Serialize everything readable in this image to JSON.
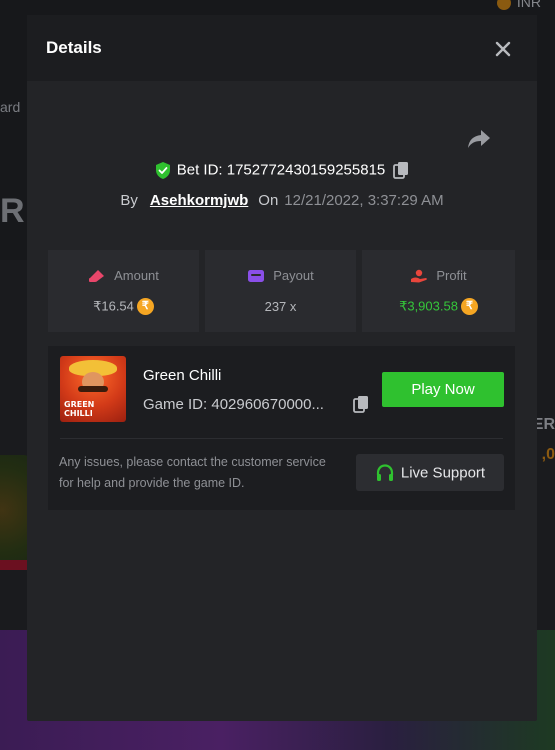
{
  "background": {
    "left_fragment": "ard",
    "big_fragment": "R",
    "top_right_currency": "INR",
    "right_fragment": "ER",
    "right_number": ",0"
  },
  "modal": {
    "title": "Details",
    "bet": {
      "label": "Bet ID:",
      "id": "1752772430159255815"
    },
    "by_label": "By",
    "username": "Asehkormjwb",
    "on_label": "On",
    "datetime": "12/21/2022, 3:37:29 AM",
    "stats": [
      {
        "label": "Amount",
        "value": "₹16.54",
        "icon": "money-icon",
        "icon_color": "#e8466a",
        "coin": true
      },
      {
        "label": "Payout",
        "value": "237 x",
        "icon": "wallet-icon",
        "icon_color": "#8a4fe8",
        "coin": false
      },
      {
        "label": "Profit",
        "value": "₹3,903.58",
        "icon": "hand-coin-icon",
        "icon_color": "#e8463c",
        "coin": true,
        "value_color": "#35c63a"
      }
    ],
    "coin_symbol": "₹",
    "game": {
      "name": "Green Chilli",
      "id_label": "Game ID:",
      "id_value": "402960670000...",
      "thumb_text": "GREEN CHILLI",
      "play_label": "Play Now"
    },
    "issue_text": "Any issues, please contact the customer service for help and provide the game ID.",
    "support_label": "Live Support"
  },
  "colors": {
    "accent_green": "#2fc12f",
    "modal_bg": "#232427",
    "header_bg": "#1c1d20",
    "coin": "#f5a623"
  }
}
